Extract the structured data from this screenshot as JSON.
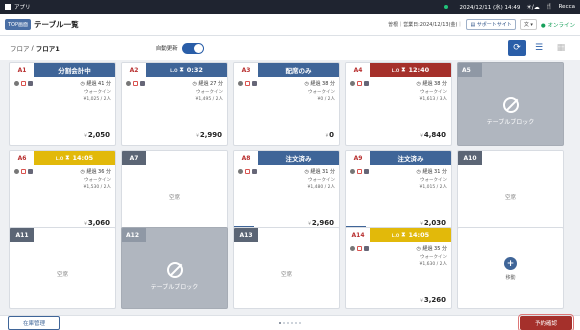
{
  "topbar": {
    "app_label": "アプリ",
    "datetime": "2024/12/11 (水) 14:49",
    "weather": "☀/☁",
    "shop": "Recca"
  },
  "header": {
    "top_badge": "TOP画面",
    "title": "テーブル一覧",
    "business_info": "曽根｜営業日:2024/12/13(金)｜",
    "support": "サポートサイト",
    "lang": "文 ▾",
    "online": "オンライン"
  },
  "toolbar": {
    "floor_label": "フロア",
    "floor_value": "フロア1",
    "auto_update": "自動更新"
  },
  "cards": [
    {
      "id": "A1",
      "status": "分割会計中",
      "style": "blue",
      "icons": true,
      "row1": "41",
      "row2": "ウォークイン",
      "row3": "1,025 / 2",
      "amount": "2,050"
    },
    {
      "id": "A2",
      "status": "0:32",
      "lo": "L.O",
      "style": "blue",
      "icons": true,
      "row1": "27",
      "row2": "ウォークイン",
      "row3": "1,495 / 2",
      "amount": "2,990"
    },
    {
      "id": "A3",
      "status": "配席のみ",
      "style": "blue",
      "icons": true,
      "row1": "38",
      "row2": "ウォークイン",
      "row3": "0 / 2",
      "amount": "0"
    },
    {
      "id": "A4",
      "status": "12:40",
      "lo": "L.O",
      "style": "red",
      "icons": true,
      "row1": "38",
      "row2": "ウォークイン",
      "row3": "1,613 / 3",
      "amount": "4,840"
    },
    {
      "id": "A5",
      "status": "テーブルブロック",
      "style": "block"
    },
    {
      "id": "A6",
      "status": "14:05",
      "lo": "L.O",
      "style": "yellow",
      "icons": true,
      "row1": "36",
      "row2": "ウォークイン",
      "row3": "1,530 / 2",
      "amount": "3,060"
    },
    {
      "id": "A7",
      "status": "空席",
      "style": "empty"
    },
    {
      "id": "A8",
      "status": "注文済み",
      "style": "blue",
      "icons": true,
      "row1": "31",
      "row2": "ウォークイン",
      "row3": "1,480 / 2",
      "amount": "2,960",
      "tag": "015"
    },
    {
      "id": "A9",
      "status": "注文済み",
      "style": "blue",
      "icons": true,
      "row1": "31",
      "row2": "ウォークイン",
      "row3": "1,015 / 2",
      "amount": "2,030",
      "tag": "015"
    },
    {
      "id": "A10",
      "status": "空席",
      "style": "empty"
    },
    {
      "id": "A11",
      "status": "空席",
      "style": "empty"
    },
    {
      "id": "A12",
      "status": "テーブルブロック",
      "style": "block"
    },
    {
      "id": "A13",
      "status": "空席",
      "style": "empty"
    },
    {
      "id": "A14",
      "status": "14:05",
      "lo": "L.O",
      "style": "yellow",
      "icons": true,
      "row1": "35",
      "row2": "ウォークイン",
      "row3": "1,630 / 2",
      "amount": "3,260"
    },
    {
      "id": "",
      "status": "移動",
      "style": "add"
    }
  ],
  "footer": {
    "stock": "在庫管理",
    "reserve": "予約確認"
  },
  "colors": {
    "blue": "#3f6598",
    "red": "#a5302b",
    "yellow": "#e2b90a",
    "block": "#b0b6bf"
  }
}
